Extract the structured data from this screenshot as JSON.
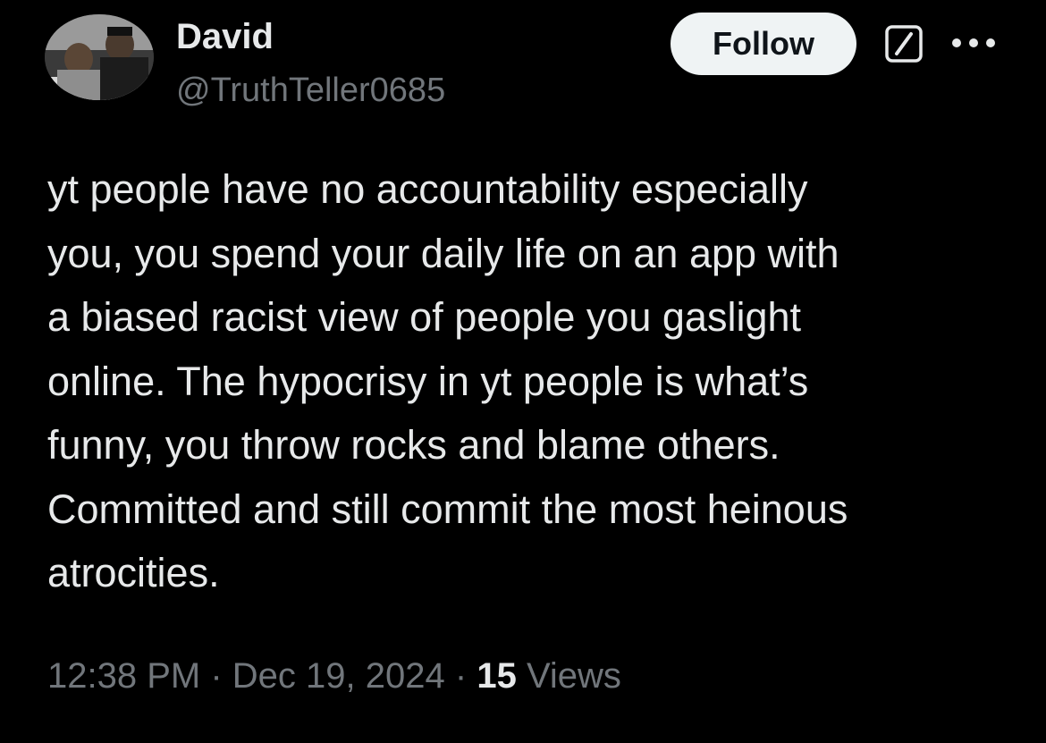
{
  "author": {
    "display_name": "David",
    "handle": "@TruthTeller0685"
  },
  "actions": {
    "follow_label": "Follow",
    "grok_icon": "grok-icon",
    "more_icon": "more-options-icon"
  },
  "tweet": {
    "text": "yt people have no accountability especially\nyou, you spend your daily life on an app with\na biased racist view of people you gaslight\nonline. The hypocrisy in yt people is what’s\nfunny, you throw rocks and blame others.\nCommitted and still commit the most heinous\natrocities."
  },
  "meta": {
    "time": "12:38 PM",
    "separator": "·",
    "date": "Dec 19, 2024",
    "views_count": "15",
    "views_label": "Views"
  },
  "colors": {
    "background": "#000000",
    "primary_text": "#e7e9ea",
    "secondary_text": "#71767b",
    "follow_button_bg": "#eff3f4",
    "follow_button_text": "#0f1419"
  }
}
